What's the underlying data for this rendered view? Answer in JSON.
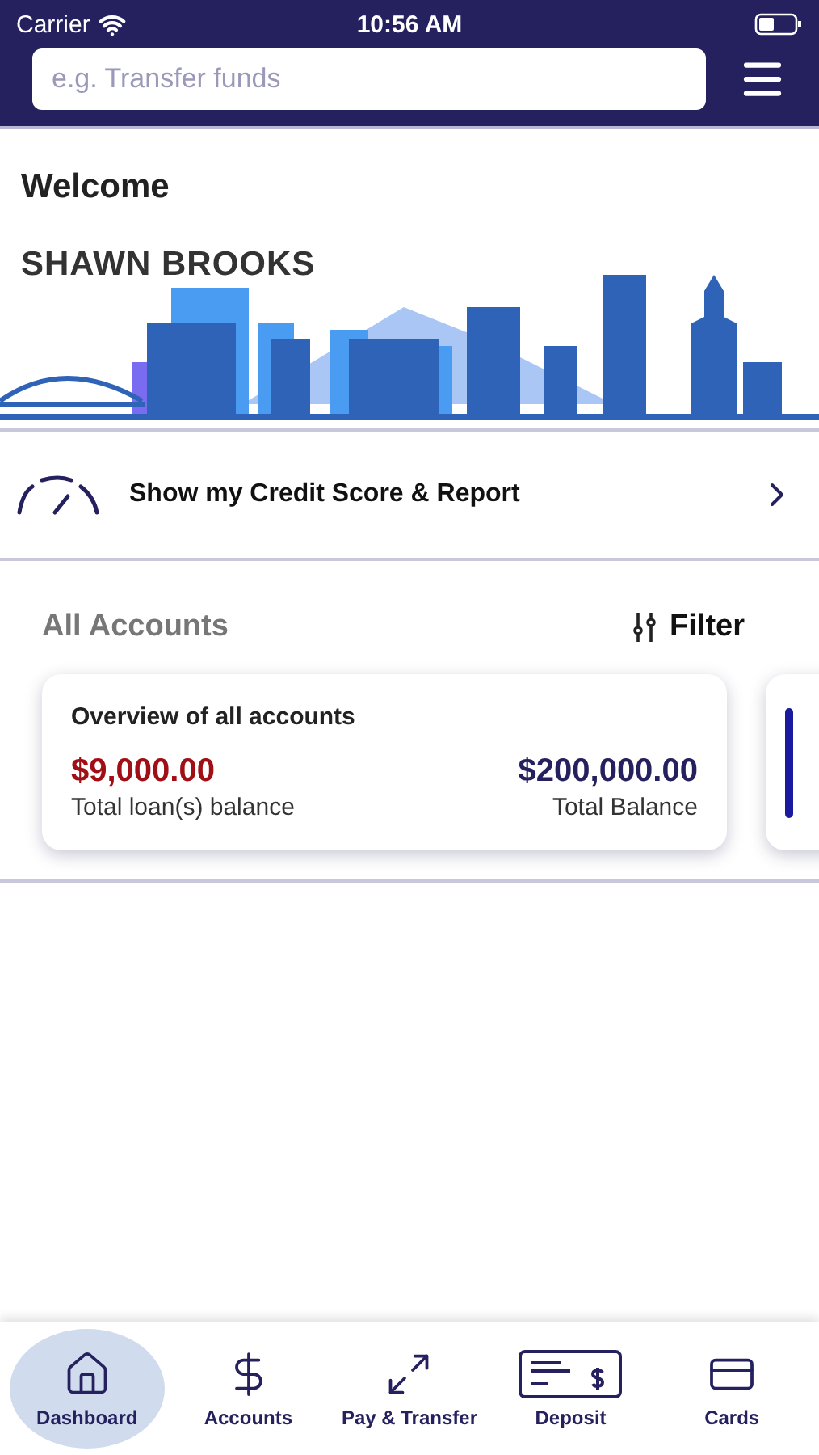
{
  "status_bar": {
    "carrier": "Carrier",
    "time": "10:56 AM"
  },
  "search": {
    "placeholder": "e.g. Transfer funds"
  },
  "welcome": "Welcome",
  "user_name": "SHAWN BROOKS",
  "credit_row": {
    "label": "Show my Credit Score & Report"
  },
  "accounts_header": {
    "title": "All Accounts",
    "filter": "Filter"
  },
  "overview_card": {
    "title": "Overview of all accounts",
    "loan_amount": "$9,000.00",
    "loan_label": "Total loan(s) balance",
    "total_amount": "$200,000.00",
    "total_label": "Total Balance"
  },
  "tabs": [
    {
      "label": "Dashboard",
      "selected": true
    },
    {
      "label": "Accounts",
      "selected": false
    },
    {
      "label": "Pay & Transfer",
      "selected": false
    },
    {
      "label": "Deposit",
      "selected": false
    },
    {
      "label": "Cards",
      "selected": false
    }
  ]
}
